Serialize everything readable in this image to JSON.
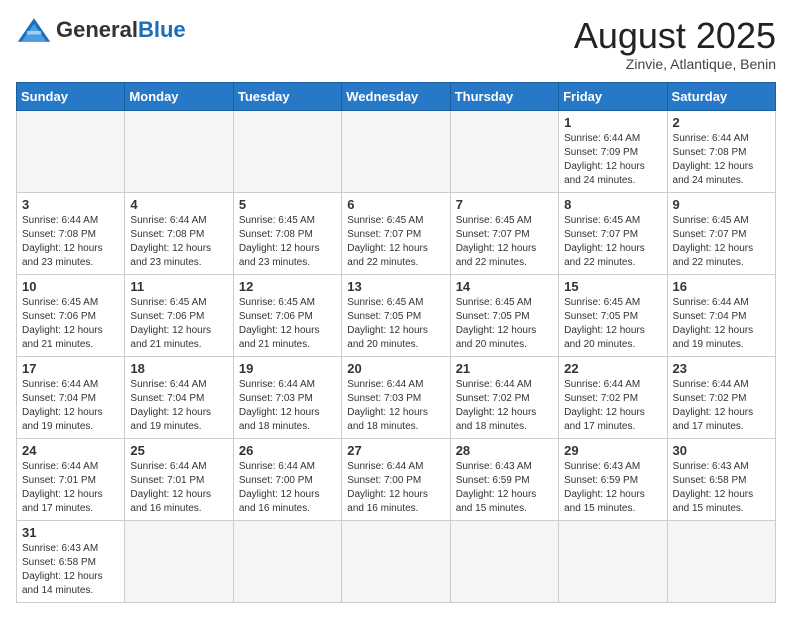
{
  "header": {
    "logo_general": "General",
    "logo_blue": "Blue",
    "month_title": "August 2025",
    "location": "Zinvie, Atlantique, Benin"
  },
  "weekdays": [
    "Sunday",
    "Monday",
    "Tuesday",
    "Wednesday",
    "Thursday",
    "Friday",
    "Saturday"
  ],
  "weeks": [
    [
      {
        "day": "",
        "info": ""
      },
      {
        "day": "",
        "info": ""
      },
      {
        "day": "",
        "info": ""
      },
      {
        "day": "",
        "info": ""
      },
      {
        "day": "",
        "info": ""
      },
      {
        "day": "1",
        "info": "Sunrise: 6:44 AM\nSunset: 7:09 PM\nDaylight: 12 hours and 24 minutes."
      },
      {
        "day": "2",
        "info": "Sunrise: 6:44 AM\nSunset: 7:08 PM\nDaylight: 12 hours and 24 minutes."
      }
    ],
    [
      {
        "day": "3",
        "info": "Sunrise: 6:44 AM\nSunset: 7:08 PM\nDaylight: 12 hours and 23 minutes."
      },
      {
        "day": "4",
        "info": "Sunrise: 6:44 AM\nSunset: 7:08 PM\nDaylight: 12 hours and 23 minutes."
      },
      {
        "day": "5",
        "info": "Sunrise: 6:45 AM\nSunset: 7:08 PM\nDaylight: 12 hours and 23 minutes."
      },
      {
        "day": "6",
        "info": "Sunrise: 6:45 AM\nSunset: 7:07 PM\nDaylight: 12 hours and 22 minutes."
      },
      {
        "day": "7",
        "info": "Sunrise: 6:45 AM\nSunset: 7:07 PM\nDaylight: 12 hours and 22 minutes."
      },
      {
        "day": "8",
        "info": "Sunrise: 6:45 AM\nSunset: 7:07 PM\nDaylight: 12 hours and 22 minutes."
      },
      {
        "day": "9",
        "info": "Sunrise: 6:45 AM\nSunset: 7:07 PM\nDaylight: 12 hours and 22 minutes."
      }
    ],
    [
      {
        "day": "10",
        "info": "Sunrise: 6:45 AM\nSunset: 7:06 PM\nDaylight: 12 hours and 21 minutes."
      },
      {
        "day": "11",
        "info": "Sunrise: 6:45 AM\nSunset: 7:06 PM\nDaylight: 12 hours and 21 minutes."
      },
      {
        "day": "12",
        "info": "Sunrise: 6:45 AM\nSunset: 7:06 PM\nDaylight: 12 hours and 21 minutes."
      },
      {
        "day": "13",
        "info": "Sunrise: 6:45 AM\nSunset: 7:05 PM\nDaylight: 12 hours and 20 minutes."
      },
      {
        "day": "14",
        "info": "Sunrise: 6:45 AM\nSunset: 7:05 PM\nDaylight: 12 hours and 20 minutes."
      },
      {
        "day": "15",
        "info": "Sunrise: 6:45 AM\nSunset: 7:05 PM\nDaylight: 12 hours and 20 minutes."
      },
      {
        "day": "16",
        "info": "Sunrise: 6:44 AM\nSunset: 7:04 PM\nDaylight: 12 hours and 19 minutes."
      }
    ],
    [
      {
        "day": "17",
        "info": "Sunrise: 6:44 AM\nSunset: 7:04 PM\nDaylight: 12 hours and 19 minutes."
      },
      {
        "day": "18",
        "info": "Sunrise: 6:44 AM\nSunset: 7:04 PM\nDaylight: 12 hours and 19 minutes."
      },
      {
        "day": "19",
        "info": "Sunrise: 6:44 AM\nSunset: 7:03 PM\nDaylight: 12 hours and 18 minutes."
      },
      {
        "day": "20",
        "info": "Sunrise: 6:44 AM\nSunset: 7:03 PM\nDaylight: 12 hours and 18 minutes."
      },
      {
        "day": "21",
        "info": "Sunrise: 6:44 AM\nSunset: 7:02 PM\nDaylight: 12 hours and 18 minutes."
      },
      {
        "day": "22",
        "info": "Sunrise: 6:44 AM\nSunset: 7:02 PM\nDaylight: 12 hours and 17 minutes."
      },
      {
        "day": "23",
        "info": "Sunrise: 6:44 AM\nSunset: 7:02 PM\nDaylight: 12 hours and 17 minutes."
      }
    ],
    [
      {
        "day": "24",
        "info": "Sunrise: 6:44 AM\nSunset: 7:01 PM\nDaylight: 12 hours and 17 minutes."
      },
      {
        "day": "25",
        "info": "Sunrise: 6:44 AM\nSunset: 7:01 PM\nDaylight: 12 hours and 16 minutes."
      },
      {
        "day": "26",
        "info": "Sunrise: 6:44 AM\nSunset: 7:00 PM\nDaylight: 12 hours and 16 minutes."
      },
      {
        "day": "27",
        "info": "Sunrise: 6:44 AM\nSunset: 7:00 PM\nDaylight: 12 hours and 16 minutes."
      },
      {
        "day": "28",
        "info": "Sunrise: 6:43 AM\nSunset: 6:59 PM\nDaylight: 12 hours and 15 minutes."
      },
      {
        "day": "29",
        "info": "Sunrise: 6:43 AM\nSunset: 6:59 PM\nDaylight: 12 hours and 15 minutes."
      },
      {
        "day": "30",
        "info": "Sunrise: 6:43 AM\nSunset: 6:58 PM\nDaylight: 12 hours and 15 minutes."
      }
    ],
    [
      {
        "day": "31",
        "info": "Sunrise: 6:43 AM\nSunset: 6:58 PM\nDaylight: 12 hours and 14 minutes."
      },
      {
        "day": "",
        "info": ""
      },
      {
        "day": "",
        "info": ""
      },
      {
        "day": "",
        "info": ""
      },
      {
        "day": "",
        "info": ""
      },
      {
        "day": "",
        "info": ""
      },
      {
        "day": "",
        "info": ""
      }
    ]
  ]
}
